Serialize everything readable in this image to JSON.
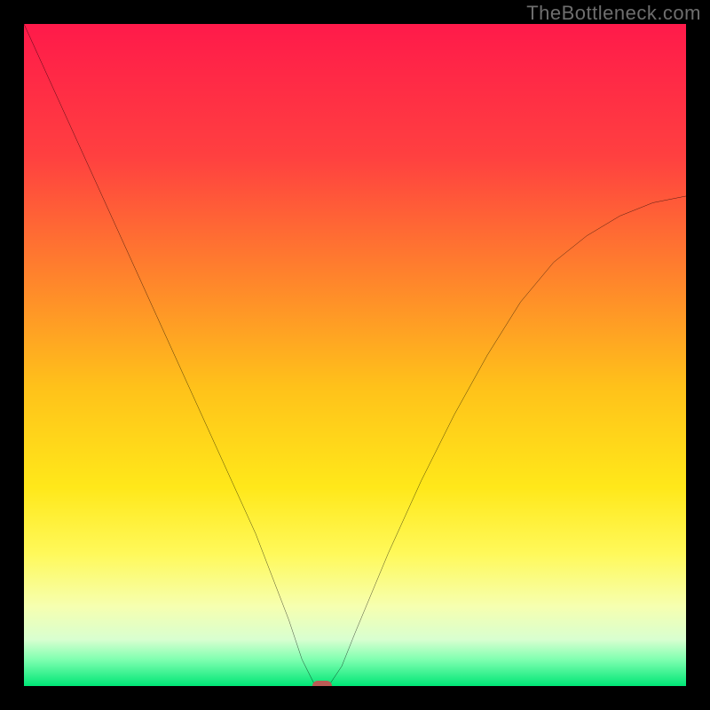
{
  "watermark": "TheBottleneck.com",
  "chart_data": {
    "type": "line",
    "title": "",
    "xlabel": "",
    "ylabel": "",
    "xlim": [
      0,
      100
    ],
    "ylim": [
      0,
      100
    ],
    "grid": false,
    "legend": false,
    "gradient_stops": [
      {
        "pos": 0.0,
        "color": "#ff1a4a"
      },
      {
        "pos": 0.2,
        "color": "#ff4040"
      },
      {
        "pos": 0.4,
        "color": "#ff8a2a"
      },
      {
        "pos": 0.55,
        "color": "#ffc21a"
      },
      {
        "pos": 0.7,
        "color": "#ffe81a"
      },
      {
        "pos": 0.8,
        "color": "#fff95a"
      },
      {
        "pos": 0.88,
        "color": "#f6ffb0"
      },
      {
        "pos": 0.93,
        "color": "#d8ffd0"
      },
      {
        "pos": 0.96,
        "color": "#7fffb0"
      },
      {
        "pos": 1.0,
        "color": "#00e676"
      }
    ],
    "series": [
      {
        "name": "bottleneck-curve",
        "color": "#000000",
        "x": [
          0,
          5,
          10,
          15,
          20,
          25,
          30,
          35,
          40,
          42,
          44,
          45,
          46,
          48,
          50,
          55,
          60,
          65,
          70,
          75,
          80,
          85,
          90,
          95,
          100
        ],
        "y": [
          100,
          89,
          78,
          67,
          56,
          45,
          34,
          23,
          10,
          4,
          0,
          0,
          0,
          3,
          8,
          20,
          31,
          41,
          50,
          58,
          64,
          68,
          71,
          73,
          74
        ]
      }
    ],
    "marker": {
      "x": 45,
      "y": 0,
      "color": "#bb5b55"
    }
  }
}
